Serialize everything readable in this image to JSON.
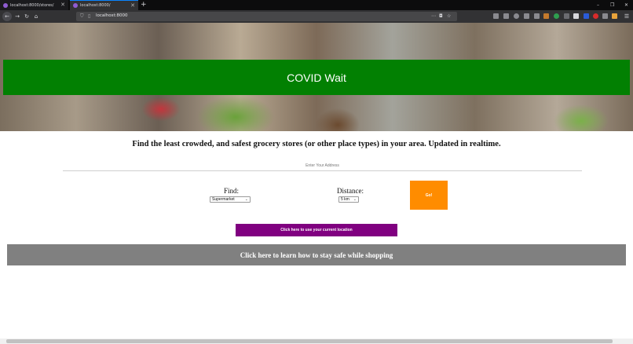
{
  "browser": {
    "tabs": [
      {
        "title": "localhost:8000/stores/",
        "active": false
      },
      {
        "title": "localhost:8000/",
        "active": true
      }
    ],
    "new_tab_symbol": "+",
    "url": "localhost:8000",
    "window_controls": {
      "minimize": "–",
      "maximize": "❐",
      "close": "✕"
    }
  },
  "icons": {
    "back": "back-arrow-icon",
    "forward": "forward-arrow-icon",
    "reload": "reload-icon",
    "home": "home-icon"
  },
  "hero": {
    "title": "COVID Wait"
  },
  "tagline": "Find the least crowded, and safest grocery stores (or other place types) in your area. Updated in realtime.",
  "address": {
    "placeholder": "Enter Your Address",
    "value": ""
  },
  "find": {
    "label": "Find:",
    "selected": "Supermarket"
  },
  "distance": {
    "label": "Distance:",
    "selected": "5 km"
  },
  "go_button": "Go!",
  "location_button": "Click here to use your current location",
  "safety_bar": "Click here to learn how to stay safe while shopping",
  "colors": {
    "header_green": "#028002",
    "go_orange": "#ff8c00",
    "location_purple": "#800080",
    "safety_gray": "#808080"
  }
}
